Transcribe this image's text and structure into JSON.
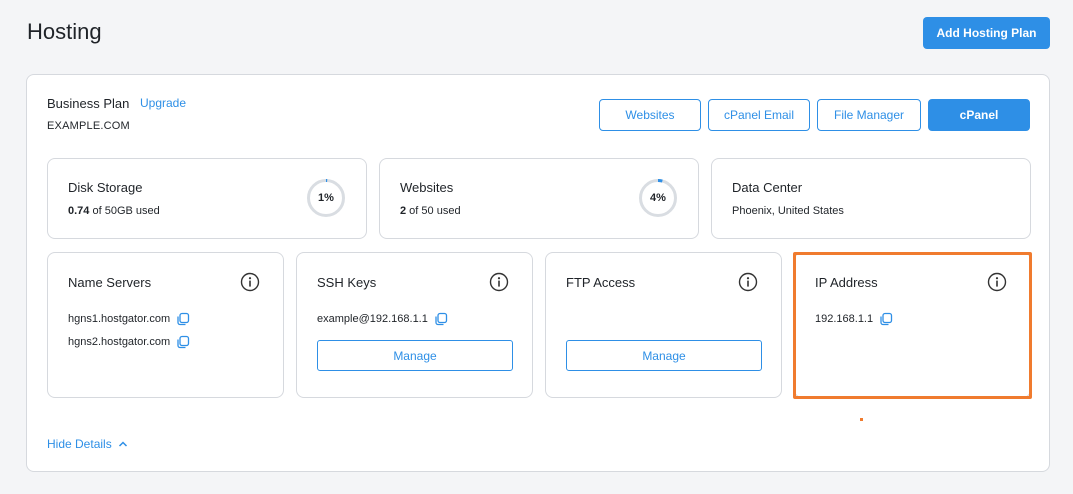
{
  "page": {
    "title": "Hosting",
    "add_plan_label": "Add Hosting Plan"
  },
  "plan": {
    "name": "Business Plan",
    "upgrade_label": "Upgrade",
    "domain": "EXAMPLE.COM",
    "hide_details_label": "Hide Details"
  },
  "actions": {
    "websites_label": "Websites",
    "cpanel_email_label": "cPanel Email",
    "file_manager_label": "File Manager",
    "cpanel_label": "cPanel"
  },
  "disk_storage": {
    "title": "Disk Storage",
    "used_value": "0.74",
    "used_suffix": " of 50GB used",
    "percent_label": "1%",
    "percent": 1
  },
  "websites": {
    "title": "Websites",
    "used_value": "2",
    "used_suffix": " of 50 used",
    "percent_label": "4%",
    "percent": 4
  },
  "data_center": {
    "title": "Data Center",
    "location": "Phoenix, United States"
  },
  "name_servers": {
    "title": "Name Servers",
    "servers": [
      "hgns1.hostgator.com",
      "hgns2.hostgator.com"
    ]
  },
  "ssh_keys": {
    "title": "SSH Keys",
    "value": "example@192.168.1.1",
    "manage_label": "Manage"
  },
  "ftp_access": {
    "title": "FTP Access",
    "manage_label": "Manage"
  },
  "ip_address": {
    "title": "IP Address",
    "value": "192.168.1.1"
  },
  "colors": {
    "accent": "#2e8fe6",
    "highlight": "#f07b2e",
    "ring_track": "#d9dde2"
  },
  "icons": {
    "info": "info-circle-icon",
    "copy": "copy-icon",
    "chevron": "chevron-up-icon"
  }
}
